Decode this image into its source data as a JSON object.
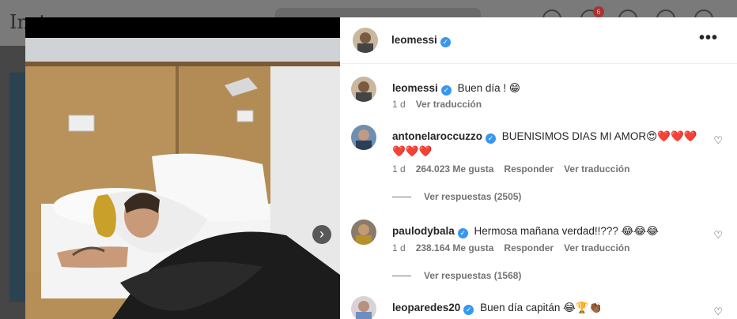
{
  "background": {
    "logo": "Inst",
    "notification_count": "6"
  },
  "post": {
    "username": "leomessi",
    "more_label": "•••",
    "caption": {
      "username": "leomessi",
      "text": "Buen día ! 😁",
      "time": "1 d",
      "translate": "Ver traducción"
    }
  },
  "comments": [
    {
      "username": "antonelaroccuzzo",
      "text": "BUENISIMOS DIAS MI AMOR😍❤️❤️❤️❤️❤️❤️",
      "time": "1 d",
      "likes": "264.023 Me gusta",
      "reply": "Responder",
      "translate": "Ver traducción",
      "view_replies": "Ver respuestas (2505)"
    },
    {
      "username": "paulodybala",
      "text": "Hermosa mañana verdad!!??? 😂😂😂",
      "time": "1 d",
      "likes": "238.164 Me gusta",
      "reply": "Responder",
      "translate": "Ver traducción",
      "view_replies": "Ver respuestas (1568)"
    },
    {
      "username": "leoparedes20",
      "text": "Buen día capitán 😂🏆👏🏾"
    }
  ],
  "icons": {
    "verified": "✓",
    "heart": "♡",
    "next": "›"
  },
  "colors": {
    "verified": "#3797f0",
    "meta": "#737373",
    "text": "#262626"
  }
}
